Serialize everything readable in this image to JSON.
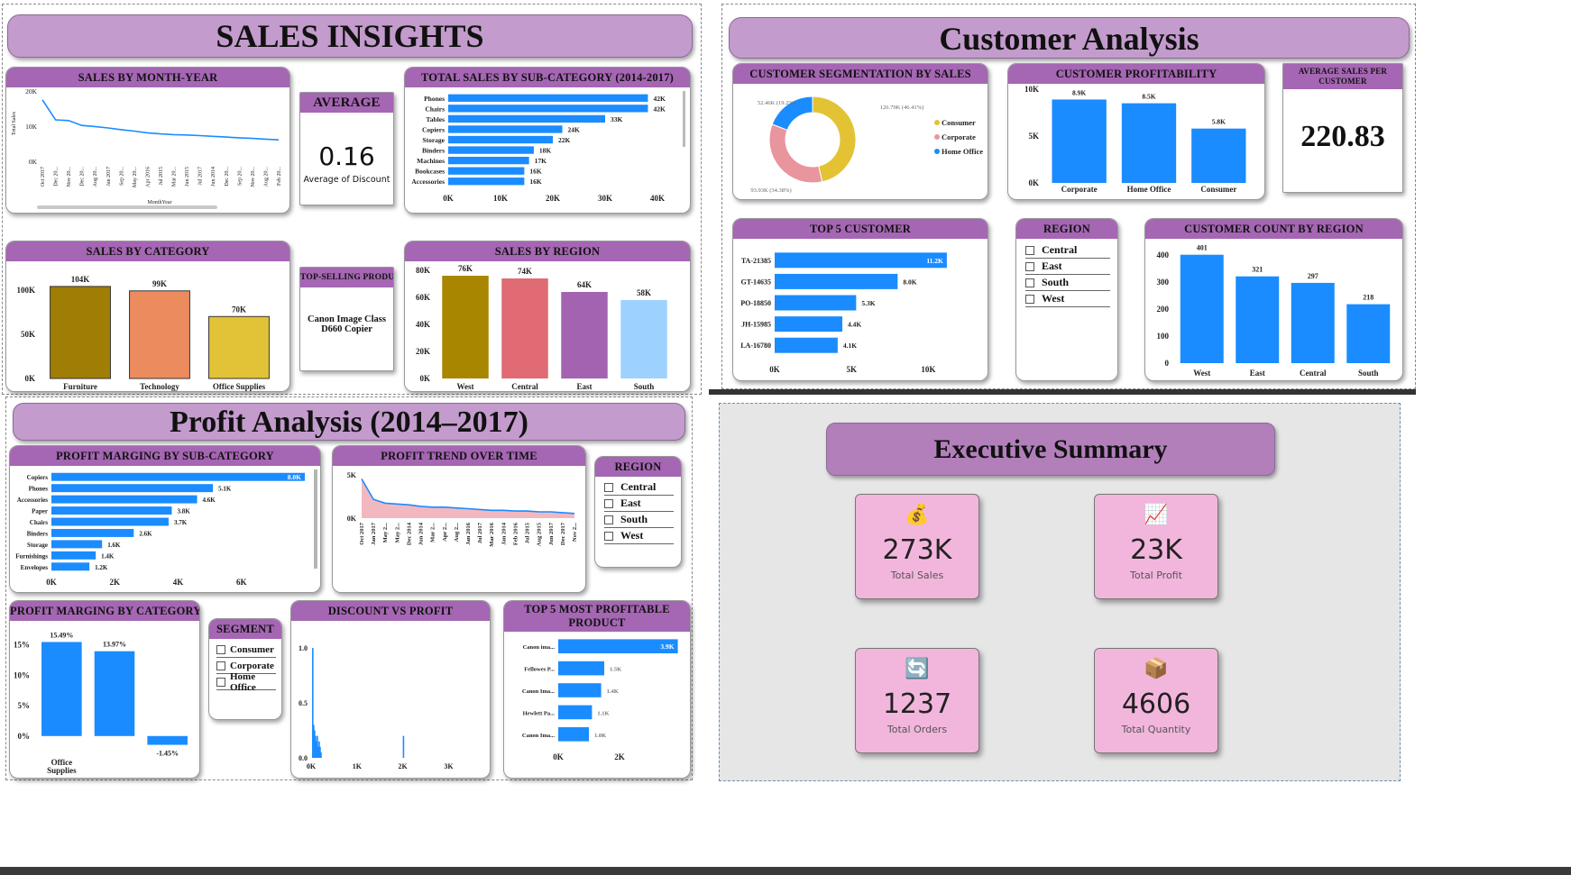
{
  "sales": {
    "title": "SALES INSIGHTS",
    "average": {
      "header": "AVERAGE",
      "value": "0.16",
      "label": "Average of Discount"
    },
    "top_product": {
      "header": "TOP-SELLING PRODUCT",
      "value": "Canon Image Class D660 Copier"
    }
  },
  "customer": {
    "title": "Customer Analysis",
    "avg_sales": {
      "header": "AVERAGE SALES PER CUSTOMER",
      "value": "220.83"
    },
    "region_slicer": {
      "header": "REGION",
      "items": [
        "Central",
        "East",
        "South",
        "West"
      ]
    }
  },
  "profit": {
    "title": "Profit Analysis (2014–2017)",
    "region_slicer": {
      "header": "REGION",
      "items": [
        "Central",
        "East",
        "South",
        "West"
      ]
    },
    "segment_slicer": {
      "header": "SEGMENT",
      "items": [
        "Consumer",
        "Corporate",
        "Home Office"
      ]
    }
  },
  "exec": {
    "title": "Executive Summary",
    "kpis": [
      {
        "value": "273K",
        "label": "Total Sales",
        "icon": "money-bag-icon",
        "glyph": "💰"
      },
      {
        "value": "23K",
        "label": "Total Profit",
        "icon": "profit-chart-icon",
        "glyph": "📈"
      },
      {
        "value": "1237",
        "label": "Total Orders",
        "icon": "refresh-orders-icon",
        "glyph": "🔄"
      },
      {
        "value": "4606",
        "label": "Total Quantity",
        "icon": "boxes-icon",
        "glyph": "📦"
      }
    ]
  },
  "colors": {
    "header": "#a566b3",
    "pill": "#c39bcc",
    "bar": "#1a8cff",
    "kpi": "#f2b6dc"
  },
  "chart_data": [
    {
      "id": "sales-by-month-year",
      "type": "line",
      "title": "SALES BY MONTH-YEAR",
      "xlabel": "MonthYear",
      "ylabel": "Total Sales",
      "x": [
        "Oct 2017",
        "Dec 20...",
        "Nov 20...",
        "Dec 20...",
        "Aug 20...",
        "Jan 2017",
        "Sep 20...",
        "May 20...",
        "Apr 2016",
        "Jul 2015",
        "Mar 20...",
        "Jun 2015",
        "Jul 2017",
        "Jun 2014",
        "Dec 20...",
        "Sep 20...",
        "Nov 20...",
        "Aug 20...",
        "Feb 20..."
      ],
      "values": [
        17500,
        11800,
        11600,
        10200,
        9900,
        9500,
        9000,
        8600,
        8100,
        7800,
        7600,
        7500,
        7300,
        7100,
        6900,
        6700,
        6500,
        6300,
        6100
      ],
      "yticks": [
        "0K",
        "10K",
        "20K"
      ],
      "ylim": [
        0,
        20000
      ]
    },
    {
      "id": "sales-by-subcategory",
      "type": "bar",
      "orientation": "horizontal",
      "title": "TOTAL SALES BY SUB-CATEGORY (2014-2017)",
      "categories": [
        "Phones",
        "Chairs",
        "Tables",
        "Copiers",
        "Storage",
        "Binders",
        "Machines",
        "Bookcases",
        "Accessories"
      ],
      "values": [
        42,
        42,
        33,
        24,
        22,
        18,
        17,
        16,
        16
      ],
      "labels": [
        "42K",
        "42K",
        "33K",
        "24K",
        "22K",
        "18K",
        "17K",
        "16K",
        "16K"
      ],
      "xticks": [
        "0K",
        "10K",
        "20K",
        "30K",
        "40K"
      ],
      "xlim": [
        0,
        44
      ]
    },
    {
      "id": "sales-by-category",
      "type": "bar",
      "title": "SALES BY CATEGORY",
      "categories": [
        "Furniture",
        "Technology",
        "Office Supplies"
      ],
      "values": [
        104,
        99,
        70
      ],
      "labels": [
        "104K",
        "99K",
        "70K"
      ],
      "colors": [
        "#a07e06",
        "#ec8b5e",
        "#e2c236"
      ],
      "yticks": [
        "0K",
        "50K",
        "100K"
      ],
      "ylim": [
        0,
        110
      ]
    },
    {
      "id": "sales-by-region",
      "type": "bar",
      "title": "SALES BY REGION",
      "categories": [
        "West",
        "Central",
        "East",
        "South"
      ],
      "values": [
        76,
        74,
        64,
        58
      ],
      "labels": [
        "76K",
        "74K",
        "64K",
        "58K"
      ],
      "colors": [
        "#a88600",
        "#e06b75",
        "#a463b0",
        "#9dd2ff"
      ],
      "yticks": [
        "0K",
        "20K",
        "40K",
        "60K",
        "80K"
      ],
      "ylim": [
        0,
        80
      ]
    },
    {
      "id": "customer-segmentation",
      "type": "pie",
      "title": "CUSTOMER SEGMENTATION BY SALES",
      "categories": [
        "Consumer",
        "Corporate",
        "Home Office"
      ],
      "values": [
        126.79,
        93.93,
        52.46
      ],
      "labels": [
        "126.79K (46.41%)",
        "93.93K (34.38%)",
        "52.46K (19.2%)"
      ],
      "colors": [
        "#e3c234",
        "#e9959e",
        "#1a8cff"
      ]
    },
    {
      "id": "customer-profitability",
      "type": "bar",
      "title": "CUSTOMER PROFITABILITY",
      "categories": [
        "Corporate",
        "Home Office",
        "Consumer"
      ],
      "values": [
        8.9,
        8.5,
        5.8
      ],
      "labels": [
        "8.9K",
        "8.5K",
        "5.8K"
      ],
      "yticks": [
        "0K",
        "5K",
        "10K"
      ],
      "ylim": [
        0,
        10
      ]
    },
    {
      "id": "top5-customer",
      "type": "bar",
      "orientation": "horizontal",
      "title": "TOP 5 CUSTOMER",
      "categories": [
        "TA-21385",
        "GT-14635",
        "PO-18850",
        "JH-15985",
        "LA-16780"
      ],
      "values": [
        11.2,
        8.0,
        5.3,
        4.4,
        4.1
      ],
      "labels": [
        "11.2K",
        "8.0K",
        "5.3K",
        "4.4K",
        "4.1K"
      ],
      "xticks": [
        "0K",
        "5K",
        "10K"
      ],
      "xlim": [
        0,
        11.5
      ]
    },
    {
      "id": "customer-count-region",
      "type": "bar",
      "title": "CUSTOMER COUNT BY REGION",
      "categories": [
        "West",
        "East",
        "Central",
        "South"
      ],
      "values": [
        401,
        321,
        297,
        218
      ],
      "labels": [
        "401",
        "321",
        "297",
        "218"
      ],
      "yticks": [
        "0",
        "100",
        "200",
        "300",
        "400"
      ],
      "ylim": [
        0,
        400
      ]
    },
    {
      "id": "profit-by-subcategory",
      "type": "bar",
      "orientation": "horizontal",
      "title": "PROFIT MARGING BY SUB-CATEGORY",
      "categories": [
        "Copiers",
        "Phones",
        "Accessories",
        "Paper",
        "Chairs",
        "Binders",
        "Storage",
        "Furnishings",
        "Envelopes"
      ],
      "values": [
        8.0,
        5.1,
        4.6,
        3.8,
        3.7,
        2.6,
        1.6,
        1.4,
        1.2
      ],
      "labels": [
        "8.0K",
        "5.1K",
        "4.6K",
        "3.8K",
        "3.7K",
        "2.6K",
        "1.6K",
        "1.4K",
        "1.2K"
      ],
      "xticks": [
        "0K",
        "2K",
        "4K",
        "6K"
      ],
      "xlim": [
        0,
        8.2
      ]
    },
    {
      "id": "profit-trend",
      "type": "area",
      "title": "PROFIT TREND OVER TIME",
      "x": [
        "Oct 2017",
        "Jan 2017",
        "May 2...",
        "May 2...",
        "Dec 2014",
        "Jun 2014",
        "Mar 2...",
        "Apr 2...",
        "Aug 2...",
        "Jan 2016",
        "Jul 2017",
        "Mar 2016",
        "Jan 2014",
        "Feb 2016",
        "Jul 2015",
        "Aug 2015",
        "Jun 2017",
        "Dec 2017",
        "Nov 2..."
      ],
      "values": [
        5000,
        2400,
        1900,
        1800,
        1700,
        1500,
        1400,
        1400,
        1300,
        1200,
        1100,
        1000,
        1000,
        900,
        900,
        800,
        800,
        700,
        600
      ],
      "yticks": [
        "0K",
        "5K"
      ],
      "ylim": [
        0,
        5500
      ]
    },
    {
      "id": "profit-by-category",
      "type": "bar",
      "title": "PROFIT MARGING BY CATEGORY",
      "categories": [
        "Office Supplies",
        "Technology",
        "Furniture"
      ],
      "values": [
        15.49,
        13.97,
        -1.45
      ],
      "labels": [
        "15.49%",
        "13.97%",
        "-1.45%"
      ],
      "yticks": [
        "0%",
        "5%",
        "10%",
        "15%"
      ],
      "ylim": [
        -3,
        16
      ]
    },
    {
      "id": "discount-vs-profit",
      "type": "bar",
      "title": "DISCOUNT VS PROFIT",
      "x": [
        20,
        40,
        60,
        80,
        100,
        120,
        140,
        160,
        180,
        200,
        2000
      ],
      "values": [
        1.0,
        0.3,
        0.25,
        0.2,
        0.15,
        0.2,
        0.1,
        0.15,
        0.1,
        0.05,
        0.2
      ],
      "xticks": [
        "0K",
        "1K",
        "2K",
        "3K"
      ],
      "yticks": [
        "0.0",
        "0.5",
        "1.0"
      ],
      "ylim": [
        0,
        1.05
      ],
      "xlim": [
        0,
        3700
      ]
    },
    {
      "id": "top5-profitable-product",
      "type": "bar",
      "orientation": "horizontal",
      "title": "TOP 5 MOST PROFITABLE PRODUCT",
      "categories": [
        "Canon ima...",
        "Fellowes P...",
        "Canon Ima...",
        "Hewlett Pa...",
        "Canon Ima..."
      ],
      "values": [
        3.9,
        1.5,
        1.4,
        1.1,
        1.0
      ],
      "labels": [
        "3.9K",
        "1.5K",
        "1.4K",
        "1.1K",
        "1.0K"
      ],
      "xticks": [
        "0K",
        "2K"
      ],
      "xlim": [
        0,
        4.0
      ]
    }
  ]
}
